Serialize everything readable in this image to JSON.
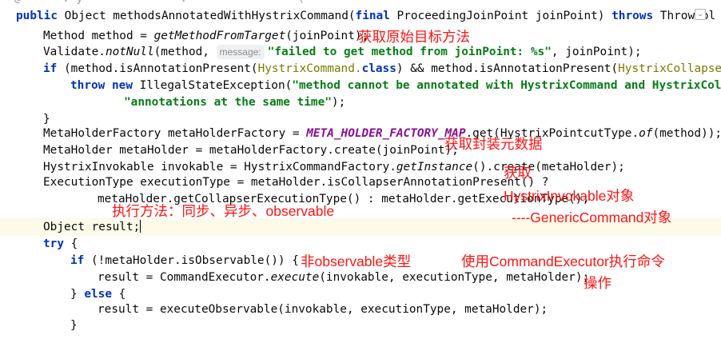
{
  "top_clip": "  @      . y              .                (                                         ",
  "fold_glyph": "⌄",
  "code": {
    "l1": {
      "kw_public": "public",
      "t1": "Object methodsAnnotatedWithHystrixCommand(",
      "kw_final": "final",
      "t2": "ProceedingJoinPoint joinPoint) ",
      "kw_throws": "throws",
      "t3": "Throwabl"
    },
    "l2": {
      "t1": "Method method = ",
      "t2": "getMethodFromTarget",
      "t3": "(joinPoint);"
    },
    "l3": {
      "t1": "Validate.",
      "t2": "notNull",
      "t3": "(method, ",
      "hint": "message:",
      "str": "\"failed to get method from joinPoint: %s\"",
      "t4": ", joinPoint);"
    },
    "l4": {
      "kw_if": "if",
      "t1": "(method.isAnnotationPresent(",
      "a1": "HystrixCommand.",
      "kw_class": "class",
      "t2": ") && method.isAnnotationPresent(",
      "a2": "HystrixCollapser"
    },
    "l5": {
      "kw_throw": "throw",
      "kw_new": "new",
      "t1": "IllegalStateException(",
      "str": "\"method cannot be annotated with HystrixCommand and HystrixColla"
    },
    "l6": {
      "str": "\"annotations at the same time\"",
      "t1": ");"
    },
    "l7": {
      "t1": "}"
    },
    "l8": {
      "t1": "MetaHolderFactory metaHolderFactory = ",
      "const": "META_HOLDER_FACTORY_MAP",
      "t2": ".get(HystrixPointcutType.",
      "t3": "of",
      "t4": "(method));"
    },
    "l9": {
      "t1": "MetaHolder metaHolder = metaHolderFactory.create(joinPoint);"
    },
    "l10": {
      "t1": "HystrixInvokable invokable = HystrixCommandFactory.",
      "t2": "getInstance",
      "t3": "().create(metaHolder);"
    },
    "l11": {
      "t1": "ExecutionType executionType = metaHolder.isCollapserAnnotationPresent() ?"
    },
    "l12": {
      "t1": "metaHolder.getCollapserExecutionType() : metaHolder.getExecutionType();"
    },
    "l13": {
      "t1": "Object result;"
    },
    "l14": {
      "kw_try": "try",
      "t1": " {"
    },
    "l15": {
      "kw_if": "if",
      "t1": " (!metaHolder.isObservable()) {"
    },
    "l16": {
      "t1": "result = CommandExecutor.",
      "t2": "execute",
      "t3": "(invokable, executionType, metaHolder);"
    },
    "l17": {
      "t1": "} ",
      "kw_else": "else",
      "t2": " {"
    },
    "l18": {
      "t1": "result = executeObservable(invokable, executionType, metaHolder);"
    },
    "l19": {
      "t1": "}"
    }
  },
  "notes": {
    "n1": "获取原始目标方法",
    "n2": "获取封装元数据",
    "n3a": "获取",
    "n3b": "HystrixInvokable对象",
    "n4": "执行方法：同步、异步、observable",
    "n5": "----GenericCommand对象",
    "n6": "非observable类型",
    "n7a": "使用CommandExecutor执行命令",
    "n7b": "操作"
  }
}
